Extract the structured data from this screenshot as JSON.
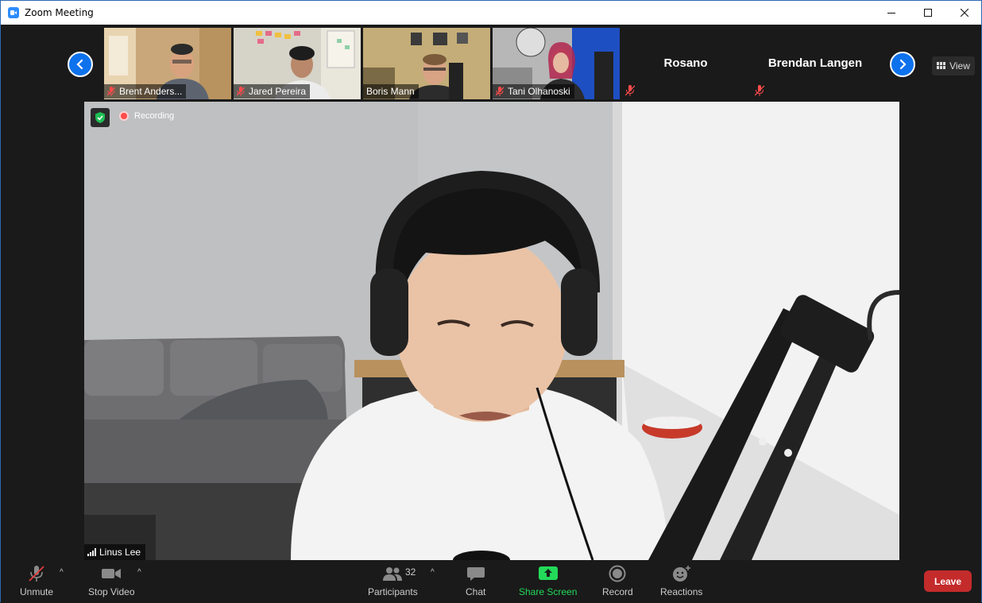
{
  "window": {
    "title": "Zoom Meeting"
  },
  "gallery": {
    "participants": [
      {
        "name": "Brent Anders...",
        "muted": true,
        "video": true
      },
      {
        "name": "Jared Pereira",
        "muted": true,
        "video": true
      },
      {
        "name": "Boris Mann",
        "muted": false,
        "video": true
      },
      {
        "name": "Tani Olhanoski",
        "muted": true,
        "video": true
      },
      {
        "name": "Rosano",
        "muted": true,
        "video": false
      },
      {
        "name": "Brendan Langen",
        "muted": true,
        "video": false
      }
    ],
    "view_label": "View"
  },
  "main": {
    "recording_label": "Recording",
    "speaker_name": "Linus Lee"
  },
  "toolbar": {
    "unmute": "Unmute",
    "stop_video": "Stop Video",
    "participants": "Participants",
    "participants_count": "32",
    "chat": "Chat",
    "share_screen": "Share Screen",
    "record": "Record",
    "reactions": "Reactions",
    "leave": "Leave"
  },
  "colors": {
    "accent": "#0e72ed",
    "leave": "#c42b2b",
    "share": "#23d959",
    "recording": "#ff4b4b"
  }
}
